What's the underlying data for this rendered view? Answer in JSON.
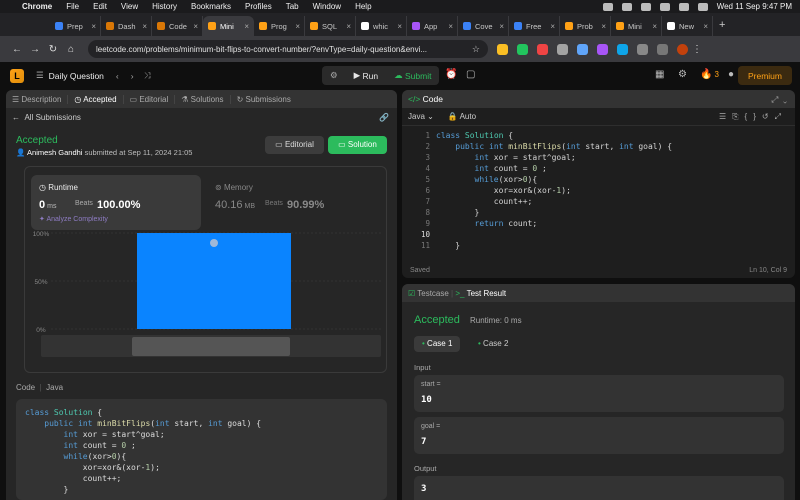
{
  "menubar": {
    "items": [
      "Chrome",
      "File",
      "Edit",
      "View",
      "History",
      "Bookmarks",
      "Profiles",
      "Tab",
      "Window",
      "Help"
    ],
    "datetime": "Wed 11 Sep  9:47 PM"
  },
  "browser_tabs": [
    {
      "label": "Prep",
      "color": "#3b82f6"
    },
    {
      "label": "Dash",
      "color": "#d97706"
    },
    {
      "label": "Code",
      "color": "#d97706"
    },
    {
      "label": "Mini",
      "color": "#ffa116",
      "active": true
    },
    {
      "label": "Prog",
      "color": "#ffa116"
    },
    {
      "label": "SQL",
      "color": "#ffa116"
    },
    {
      "label": "whic",
      "color": "#ffffff"
    },
    {
      "label": "App",
      "color": "#a855f7"
    },
    {
      "label": "Cove",
      "color": "#3b82f6"
    },
    {
      "label": "Free",
      "color": "#3b82f6"
    },
    {
      "label": "Prob",
      "color": "#ffa116"
    },
    {
      "label": "Mini",
      "color": "#ffa116"
    },
    {
      "label": "New",
      "color": "#ffffff"
    }
  ],
  "url": "leetcode.com/problems/minimum-bit-flips-to-convert-number/?envType=daily-question&envi...",
  "topbar": {
    "title": "Daily Question",
    "run": "Run",
    "submit": "Submit",
    "streak": "3",
    "premium": "Premium"
  },
  "left_tabs": [
    "Description",
    "Accepted",
    "Editorial",
    "Solutions",
    "Submissions"
  ],
  "all_submissions": "All Submissions",
  "submission": {
    "status": "Accepted",
    "user": "Animesh Gandhi",
    "submitted_text": "submitted at Sep 11, 2024 21:05",
    "editorial_btn": "Editorial",
    "solution_btn": "Solution"
  },
  "runtime": {
    "label": "Runtime",
    "value": "0",
    "unit": "ms",
    "beats_label": "Beats",
    "beats": "100.00%",
    "analyze": "Analyze Complexity"
  },
  "memory": {
    "label": "Memory",
    "value": "40.16",
    "unit": "MB",
    "beats_label": "Beats",
    "beats": "90.99%"
  },
  "chart_data": {
    "type": "bar",
    "yticks": [
      "100%",
      "50%",
      "0%"
    ],
    "ylim": [
      0,
      100
    ],
    "bars": [
      {
        "value": 100,
        "color": "#0a84ff"
      }
    ]
  },
  "code_section": {
    "label": "Code",
    "lang": "Java"
  },
  "left_code": [
    "class Solution {",
    "    public int minBitFlips(int start, int goal) {",
    "        int xor = start^goal;",
    "        int count = 0 ;",
    "        while(xor>0){",
    "            xor=xor&(xor-1);",
    "            count++;",
    "        }"
  ],
  "editor": {
    "title": "Code",
    "language": "Java",
    "mode": "Auto",
    "line_numbers": [
      "1",
      "2",
      "3",
      "4",
      "5",
      "6",
      "7",
      "8",
      "9",
      "10",
      "11"
    ],
    "lines": [
      "class Solution {",
      "    public int minBitFlips(int start, int goal) {",
      "        int xor = start^goal;",
      "        int count = 0 ;",
      "        while(xor>0){",
      "            xor=xor&(xor-1);",
      "            count++;",
      "        }",
      "        return count;",
      "",
      "    }"
    ],
    "saved": "Saved",
    "position": "Ln 10, Col 9"
  },
  "result": {
    "tab_testcase": "Testcase",
    "tab_result": "Test Result",
    "status": "Accepted",
    "runtime": "Runtime: 0 ms",
    "cases": [
      "Case 1",
      "Case 2"
    ],
    "input_label": "Input",
    "inputs": [
      {
        "name": "start =",
        "value": "10"
      },
      {
        "name": "goal =",
        "value": "7"
      }
    ],
    "output_label": "Output",
    "output": "3"
  }
}
